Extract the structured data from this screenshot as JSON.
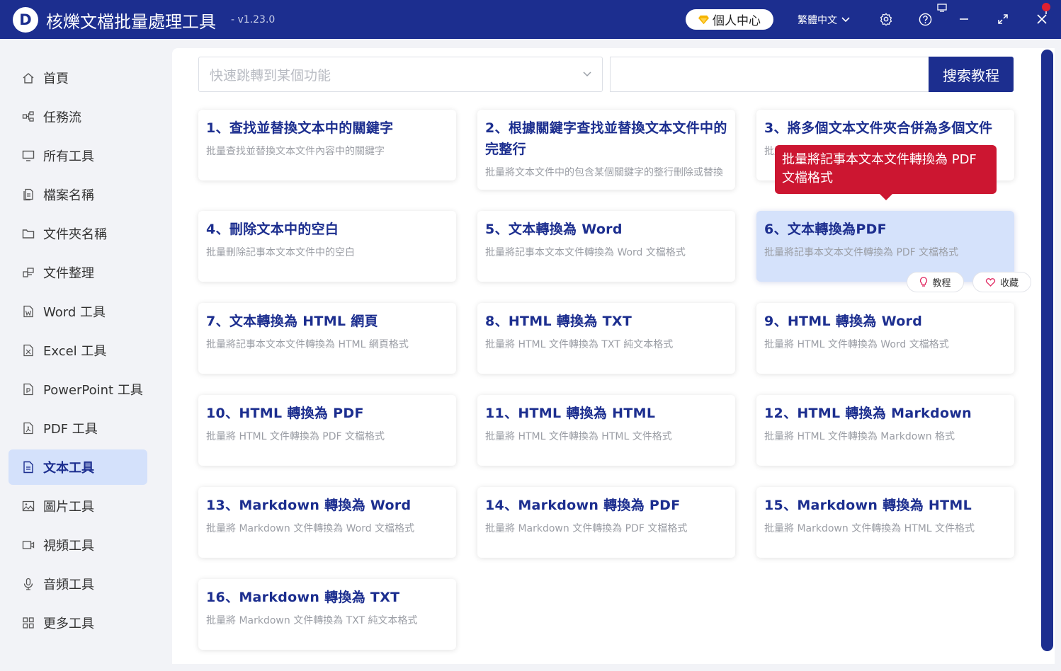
{
  "app": {
    "title": "核爍文檔批量處理工具",
    "version": "- v1.23.0",
    "logo_letter": "D"
  },
  "header": {
    "user_center": "個人中心",
    "language": "繁體中文"
  },
  "sidebar": {
    "items": [
      {
        "label": "首頁",
        "icon": "home-icon"
      },
      {
        "label": "任務流",
        "icon": "workflow-icon"
      },
      {
        "label": "所有工具",
        "icon": "monitor-icon"
      },
      {
        "label": "檔案名稱",
        "icon": "file-copy-icon"
      },
      {
        "label": "文件夾名稱",
        "icon": "folder-icon"
      },
      {
        "label": "文件整理",
        "icon": "organize-icon"
      },
      {
        "label": "Word 工具",
        "icon": "word-file-icon"
      },
      {
        "label": "Excel 工具",
        "icon": "excel-file-icon"
      },
      {
        "label": "PowerPoint 工具",
        "icon": "ppt-file-icon"
      },
      {
        "label": "PDF 工具",
        "icon": "pdf-file-icon"
      },
      {
        "label": "文本工具",
        "icon": "text-file-icon",
        "active": true
      },
      {
        "label": "圖片工具",
        "icon": "image-icon"
      },
      {
        "label": "視頻工具",
        "icon": "video-icon"
      },
      {
        "label": "音頻工具",
        "icon": "microphone-icon"
      },
      {
        "label": "更多工具",
        "icon": "grid-icon"
      }
    ]
  },
  "search": {
    "select_placeholder": "快速跳轉到某個功能",
    "input_value": "",
    "button": "搜索教程"
  },
  "cards": [
    {
      "title": "1、查找並替換文本中的關鍵字",
      "desc": "批量查找並替換文本文件內容中的關鍵字"
    },
    {
      "title": "2、根據關鍵字查找並替換文本文件中的完整行",
      "desc": "批量將文本文件中的包含某個關鍵字的整行刪除或替換"
    },
    {
      "title": "3、將多個文本文件夾合併為多個文件",
      "desc": "批量將多個文件夾中的文本文件合併為多個文件"
    },
    {
      "title": "4、刪除文本中的空白",
      "desc": "批量刪除記事本文本文件中的空白"
    },
    {
      "title": "5、文本轉換為 Word",
      "desc": "批量將記事本文本文件轉換為 Word 文檔格式"
    },
    {
      "title": "6、文本轉換為PDF",
      "desc": "批量將記事本文本文件轉換為 PDF 文檔格式",
      "highlighted": true
    },
    {
      "title": "7、文本轉換為 HTML 網頁",
      "desc": "批量將記事本文本文件轉換為 HTML 網頁格式"
    },
    {
      "title": "8、HTML 轉換為 TXT",
      "desc": "批量將 HTML 文件轉換為 TXT 純文本格式"
    },
    {
      "title": "9、HTML 轉換為 Word",
      "desc": "批量將 HTML 文件轉換為 Word 文檔格式"
    },
    {
      "title": "10、HTML 轉換為 PDF",
      "desc": "批量將 HTML 文件轉換為 PDF 文檔格式"
    },
    {
      "title": "11、HTML 轉換為 HTML",
      "desc": "批量將 HTML 文件轉換為 HTML 文件格式"
    },
    {
      "title": "12、HTML 轉換為 Markdown",
      "desc": "批量將 HTML 文件轉換為 Markdown 格式"
    },
    {
      "title": "13、Markdown 轉換為 Word",
      "desc": "批量將 Markdown 文件轉換為 Word 文檔格式"
    },
    {
      "title": "14、Markdown 轉換為 PDF",
      "desc": "批量將 Markdown 文件轉換為 PDF 文檔格式"
    },
    {
      "title": "15、Markdown 轉換為 HTML",
      "desc": "批量將 Markdown 文件轉換為 HTML 文件格式"
    },
    {
      "title": "16、Markdown 轉換為 TXT",
      "desc": "批量將 Markdown 文件轉換為 TXT 純文本格式"
    }
  ],
  "tooltip": "批量將記事本文本文件轉換為 PDF 文檔格式",
  "card_actions": {
    "tutorial": "教程",
    "favorite": "收藏"
  },
  "colors": {
    "brand": "#1c2e8f",
    "active_bg": "#d4e1fb",
    "tooltip": "#cc1631",
    "highlight_card": "#d5e2fb"
  }
}
